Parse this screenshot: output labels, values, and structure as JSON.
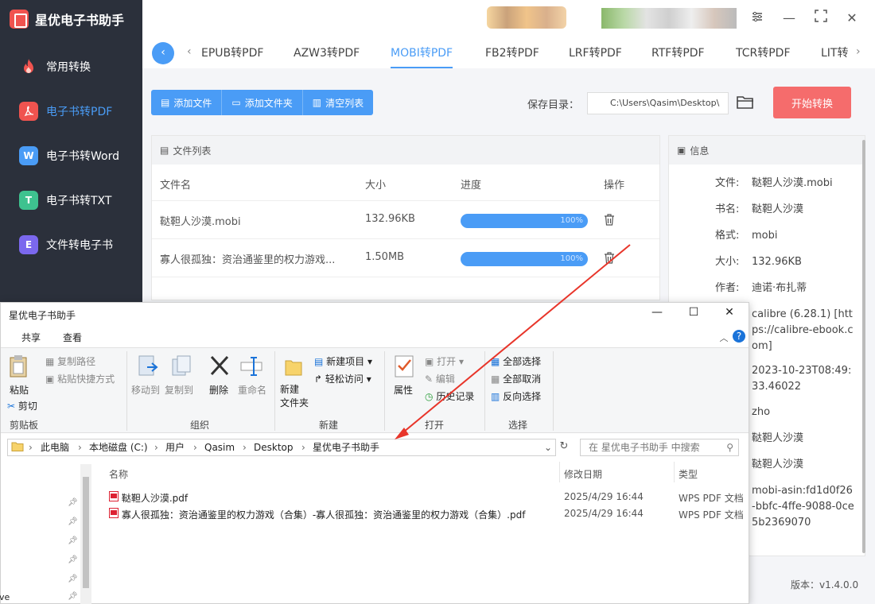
{
  "app": {
    "title": "星优电子书助手",
    "version": "版本：v1.4.0.0"
  },
  "sidebar": {
    "items": [
      {
        "label": "常用转换",
        "icon": "fire-icon",
        "color": "#f0534f"
      },
      {
        "label": "电子书转PDF",
        "icon": "pdf-icon",
        "color": "#f0534f"
      },
      {
        "label": "电子书转Word",
        "icon": "word-icon",
        "color": "#4a9cf6",
        "glyph": "W"
      },
      {
        "label": "电子书转TXT",
        "icon": "txt-icon",
        "color": "#3ec28f",
        "glyph": "T"
      },
      {
        "label": "文件转电子书",
        "icon": "ebook-icon",
        "color": "#7b68ee",
        "glyph": "E"
      }
    ]
  },
  "tabs": [
    "EPUB转PDF",
    "AZW3转PDF",
    "MOBI转PDF",
    "FB2转PDF",
    "LRF转PDF",
    "RTF转PDF",
    "TCR转PDF",
    "LIT转"
  ],
  "active_tab": "MOBI转PDF",
  "toolbar": {
    "add_file": "添加文件",
    "add_folder": "添加文件夹",
    "clear_list": "清空列表"
  },
  "save": {
    "label": "保存目录：",
    "path": "C:\\Users\\Qasim\\Desktop\\",
    "start": "开始转换"
  },
  "file_list": {
    "title": "文件列表",
    "headers": {
      "name": "文件名",
      "size": "大小",
      "progress": "进度",
      "action": "操作"
    },
    "rows": [
      {
        "name": "鞑靼人沙漠.mobi",
        "size": "132.96KB",
        "progress": "100%"
      },
      {
        "name": "寡人很孤独：资治通鉴里的权力游戏...",
        "size": "1.50MB",
        "progress": "100%"
      }
    ]
  },
  "info": {
    "title": "信息",
    "rows": [
      {
        "k": "文件:",
        "v": "鞑靼人沙漠.mobi"
      },
      {
        "k": "书名:",
        "v": "鞑靼人沙漠"
      },
      {
        "k": "格式:",
        "v": "mobi"
      },
      {
        "k": "大小:",
        "v": "132.96KB"
      },
      {
        "k": "作者:",
        "v": "迪诺·布扎蒂"
      },
      {
        "k": "",
        "v": "calibre (6.28.1) [https://calibre-ebook.com]"
      },
      {
        "k": "",
        "v": "2023-10-23T08:49:33.46022"
      },
      {
        "k": "",
        "v": "zho"
      },
      {
        "k": "",
        "v": "鞑靼人沙漠"
      },
      {
        "k": "",
        "v": "鞑靼人沙漠"
      },
      {
        "k": "",
        "v": "mobi-asin:fd1d0f26-bbfc-4ffe-9088-0ce5b2369070"
      }
    ]
  },
  "explorer": {
    "title": "星优电子书助手",
    "ribbon_tabs": [
      "共享",
      "查看"
    ],
    "clipboard": {
      "paste": "粘贴",
      "cut": "剪切",
      "copy_path": "复制路径",
      "paste_shortcut": "粘贴快捷方式",
      "group": "剪贴板"
    },
    "organize": {
      "move_to": "移动到",
      "copy_to": "复制到",
      "delete": "删除",
      "rename": "重命名",
      "group": "组织"
    },
    "new": {
      "new_folder": "新建\n文件夹",
      "new_item": "新建项目",
      "easy_access": "轻松访问",
      "group": "新建"
    },
    "open": {
      "properties": "属性",
      "open": "打开",
      "edit": "编辑",
      "history": "历史记录",
      "group": "打开"
    },
    "select": {
      "select_all": "全部选择",
      "select_none": "全部取消",
      "invert": "反向选择",
      "group": "选择"
    },
    "breadcrumbs": [
      "此电脑",
      "本地磁盘 (C:)",
      "用户",
      "Qasim",
      "Desktop",
      "星优电子书助手"
    ],
    "search_placeholder": "在 星优电子书助手 中搜索",
    "columns": {
      "name": "名称",
      "date": "修改日期",
      "type": "类型"
    },
    "files": [
      {
        "name": "鞑靼人沙漠.pdf",
        "date": "2025/4/29 16:44",
        "type": "WPS PDF 文档"
      },
      {
        "name": "寡人很孤独：资治通鉴里的权力游戏（合集）-寡人很孤独：资治通鉴里的权力游戏（合集）.pdf",
        "date": "2025/4/29 16:44",
        "type": "WPS PDF 文档"
      }
    ],
    "left_fragment": "ve"
  }
}
